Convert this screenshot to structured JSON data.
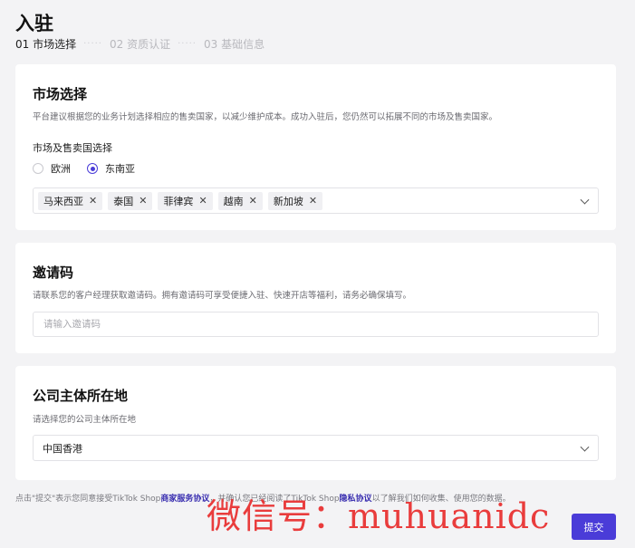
{
  "page": {
    "title": "入驻",
    "steps": [
      "01 市场选择",
      "02 资质认证",
      "03 基础信息"
    ]
  },
  "market_card": {
    "title": "市场选择",
    "description": "平台建议根据您的业务计划选择相应的售卖国家，以减少维护成本。成功入驻后，您仍然可以拓展不同的市场及售卖国家。",
    "field_label": "市场及售卖国选择",
    "regions": [
      {
        "label": "欧洲",
        "checked": false
      },
      {
        "label": "东南亚",
        "checked": true
      }
    ],
    "selected_countries": [
      "马来西亚",
      "泰国",
      "菲律宾",
      "越南",
      "新加坡"
    ]
  },
  "invite_card": {
    "title": "邀请码",
    "description": "请联系您的客户经理获取邀请码。拥有邀请码可享受便捷入驻、快速开店等福利，请务必确保填写。",
    "placeholder": "请输入邀请码"
  },
  "company_card": {
    "title": "公司主体所在地",
    "description": "请选择您的公司主体所在地",
    "selected": "中国香港"
  },
  "footer": {
    "text_1": "点击\"提交\"表示您同意接受TikTok Shop",
    "link_1": "商家服务协议",
    "text_2": "，并确认您已经阅读了TikTok Shop",
    "link_2": "隐私协议",
    "text_3": "以了解我们如何收集、使用您的数据。",
    "submit_label": "提交"
  },
  "watermark": "微信号：muhuanidc",
  "colors": {
    "accent": "#4a3cd8",
    "watermark": "#e82828"
  }
}
